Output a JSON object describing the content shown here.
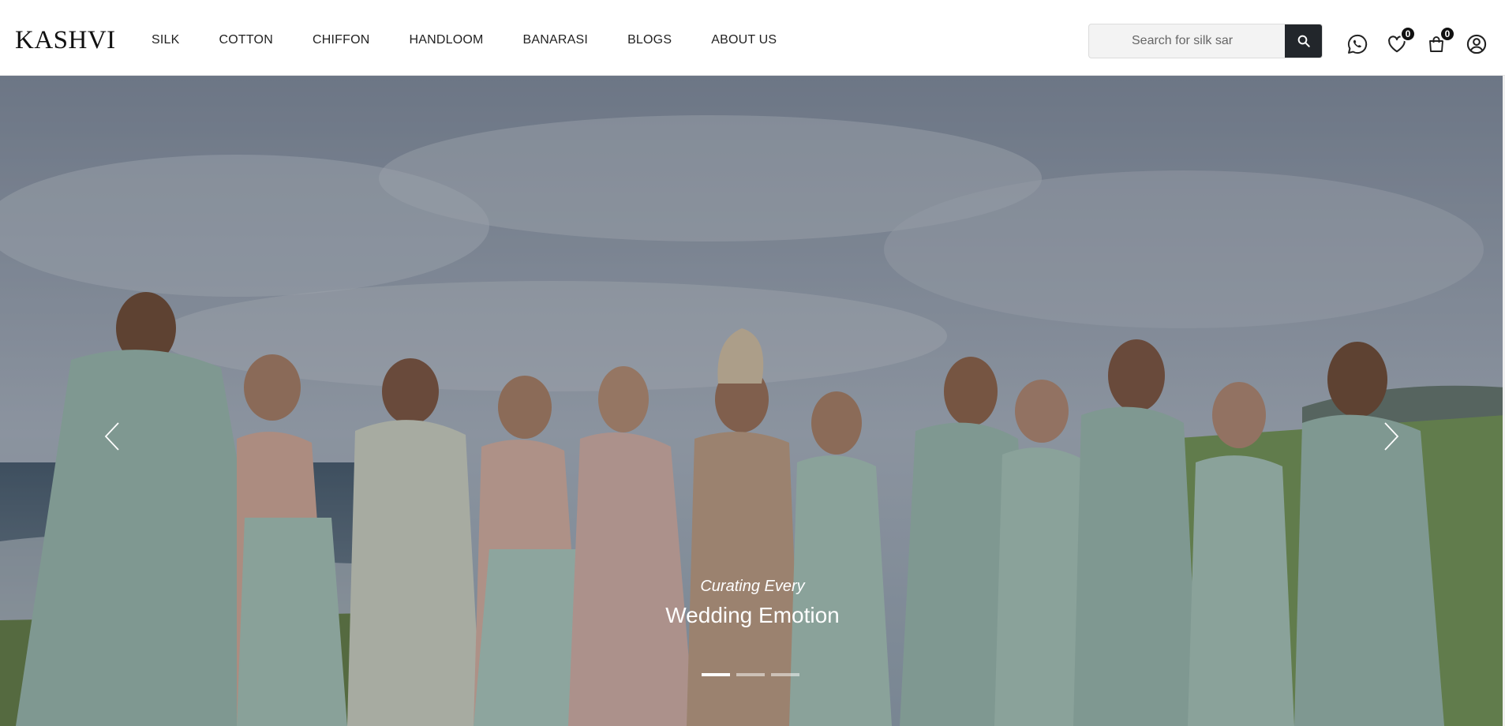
{
  "brand": {
    "logo": "KASHVI"
  },
  "nav": {
    "items": [
      {
        "label": "SILK"
      },
      {
        "label": "COTTON"
      },
      {
        "label": "CHIFFON"
      },
      {
        "label": "HANDLOOM"
      },
      {
        "label": "BANARASI"
      },
      {
        "label": "BLOGS"
      },
      {
        "label": "ABOUT US"
      }
    ]
  },
  "search": {
    "placeholder": "Search for silk sar",
    "value": ""
  },
  "header_icons": {
    "whatsapp": "whatsapp-icon",
    "wishlist": "heart-icon",
    "cart": "shopping-bag-icon",
    "account": "user-circle-icon",
    "wishlist_count": "0",
    "cart_count": "0"
  },
  "hero": {
    "subtitle": "Curating Every",
    "title": "Wedding Emotion",
    "slide_count": 3,
    "active_slide": 1
  },
  "colors": {
    "search_button": "#22262b",
    "badge": "#111111",
    "text": "#222222"
  }
}
